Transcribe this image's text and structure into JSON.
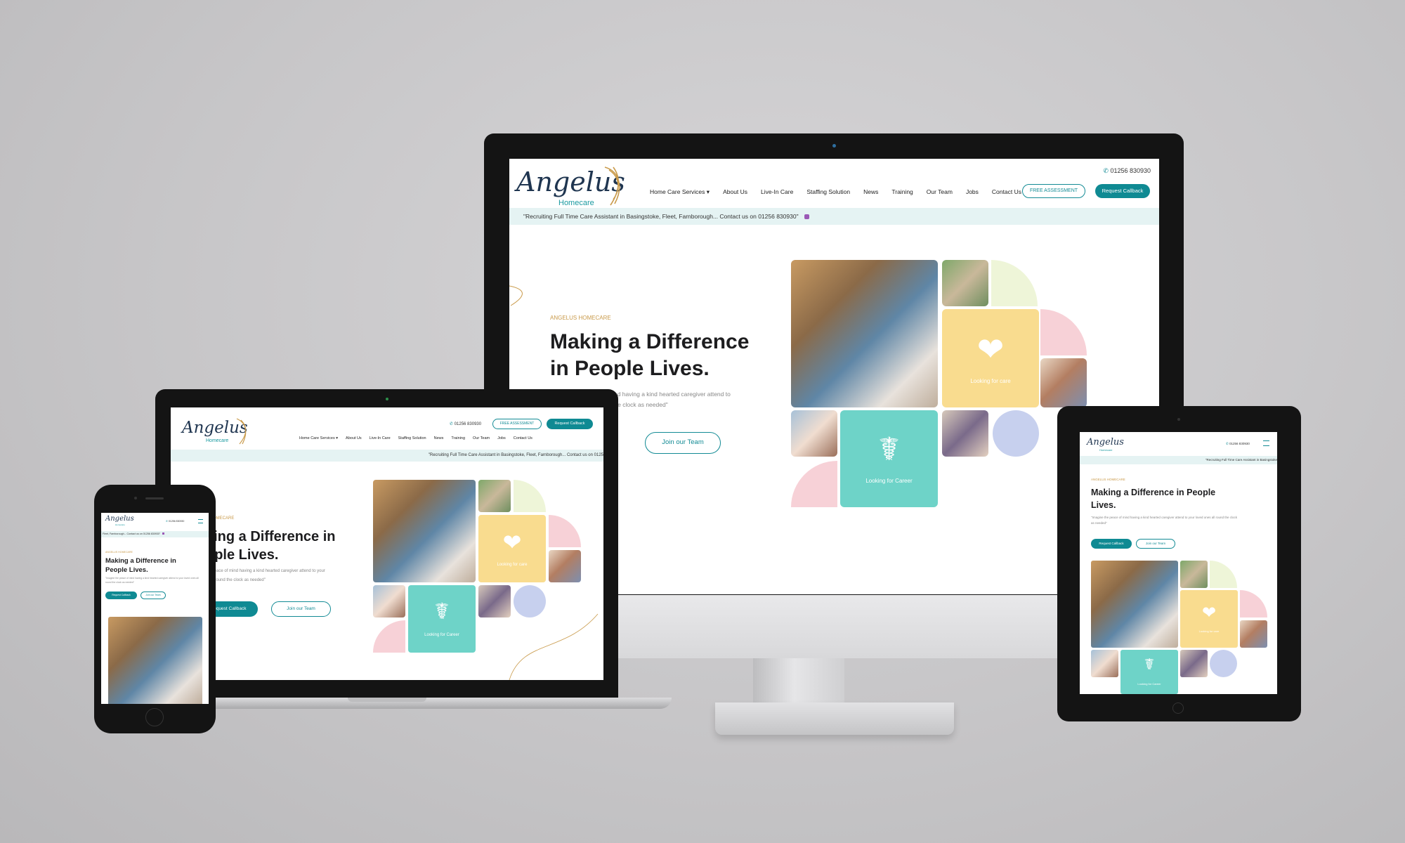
{
  "brand": {
    "logo_main": "Angelus",
    "logo_sub": "Homecare"
  },
  "contact": {
    "phone": "01256 830930",
    "phone_icon": "phone-icon"
  },
  "nav": {
    "items": [
      "Home Care Services",
      "About Us",
      "Live-In Care",
      "Staffing Solution",
      "News",
      "Training",
      "Our Team",
      "Jobs",
      "Contact Us"
    ],
    "free_assessment": "FREE ASSESSMENT",
    "request_callback": "Request Callback"
  },
  "ticker": {
    "text": "\"Recruiting Full Time Care Assistant in Basingstoke, Fleet, Farnborough... Contact us on 01256 830930\"",
    "laptop_text": "\"Recruiting Full Time Care Assistant in Basingstoke, Fleet, Farnborough... Contact us on 0125",
    "tablet_text": "\"Recruiting Full Time Care Assistant in Basingstoke",
    "phone_text": "Fleet, Farnborough... Contact us on 01256 830930\""
  },
  "hero": {
    "eyebrow": "ANGELUS HOMECARE",
    "eyebrow_laptop": "S HOMECARE",
    "title_line1": "Making a Difference",
    "title_line2": "in People Lives.",
    "title_full": "Making a Difference in People Lives.",
    "laptop_line1": "king a Difference in",
    "laptop_line2": "ople Lives.",
    "subtitle": "\"Imagine the peace of mind having a kind hearted caregiver attend to your loved ones all round the clock as needed\"",
    "desktop_sub_line1": "mind having a kind hearted caregiver attend to",
    "desktop_sub_line2": "d the clock as needed\"",
    "laptop_sub_line1": "he peace of mind having a kind hearted caregiver attend to your",
    "laptop_sub_line2": "s all round the clock as needed\"",
    "request_callback": "Request Callback",
    "laptop_request": "Request Callback",
    "desktop_request_clip": "k",
    "join_team": "Join our Team"
  },
  "tiles": {
    "care_label": "Looking for care",
    "career_label": "Looking for Career",
    "care_icon": "hands-heart-icon",
    "career_icon": "nurse-icon"
  },
  "colors": {
    "accent_teal": "#0f8a93",
    "tile_yellow": "#f9dc8f",
    "tile_teal": "#6ed3c8",
    "pink": "#f7d1d7",
    "lavender": "#c7d0ee",
    "lime": "#eef5d8",
    "eyebrow_gold": "#c99a4a"
  }
}
